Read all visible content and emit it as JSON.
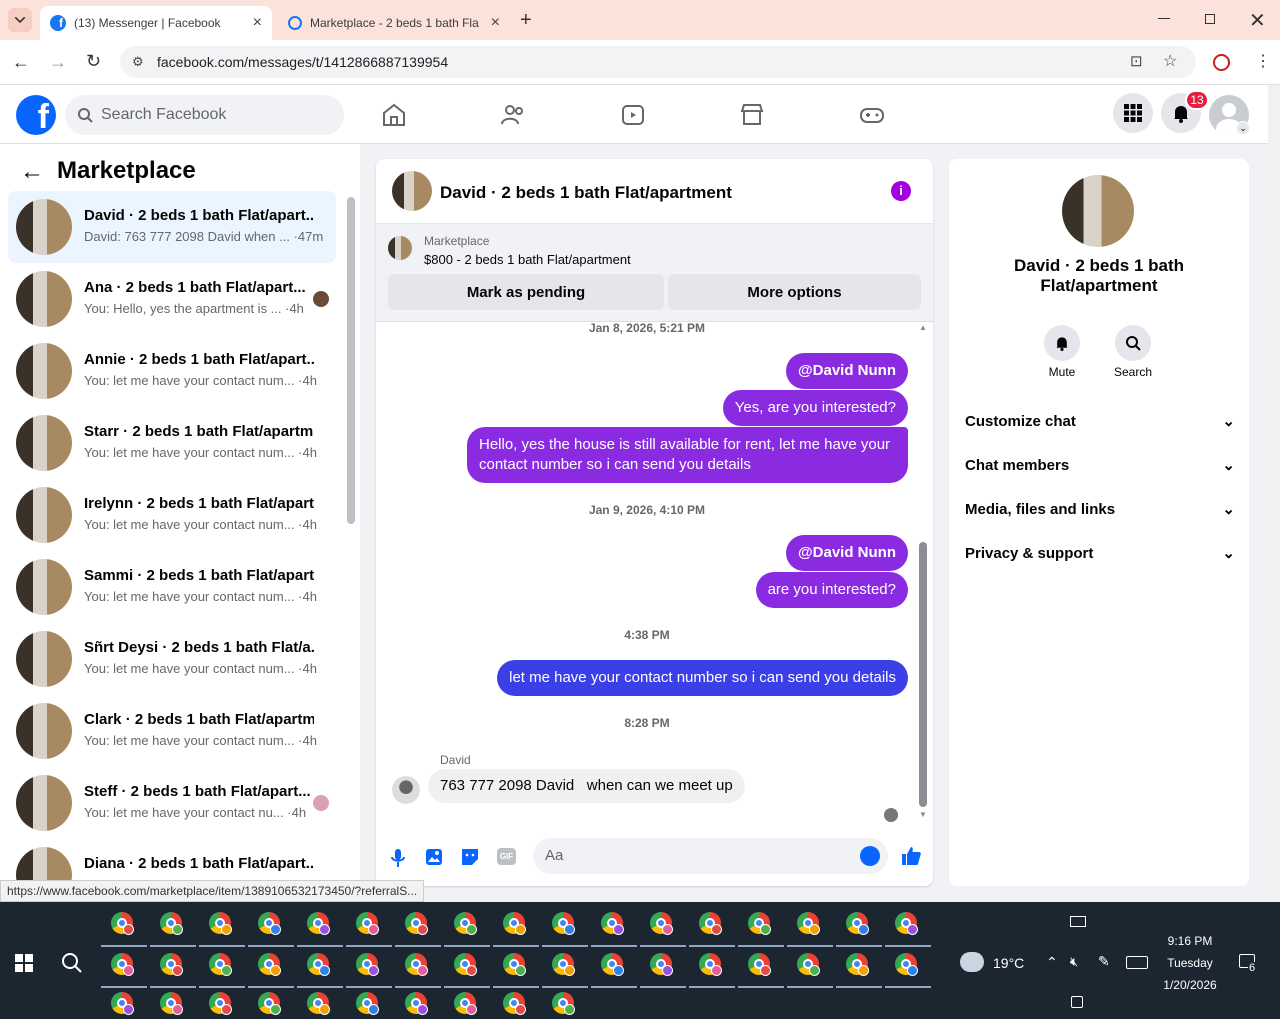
{
  "browser": {
    "tabs": [
      {
        "title": "(13) Messenger | Facebook",
        "active": true
      },
      {
        "title": "Marketplace - 2 beds 1 bath Fla",
        "active": false
      }
    ],
    "url": "facebook.com/messages/t/1412866887139954"
  },
  "fb": {
    "search_placeholder": "Search Facebook",
    "notification_count": "13"
  },
  "sidebar": {
    "title": "Marketplace",
    "conversations": [
      {
        "name": "David · 2 beds 1 bath Flat/apart...",
        "preview": "David: 763 777 2098 David when ... ·47m",
        "selected": true
      },
      {
        "name": "Ana · 2 beds 1 bath Flat/apart...",
        "preview": "You: Hello, yes the apartment is ... ·4h"
      },
      {
        "name": "Annie · 2 beds 1 bath Flat/apart...",
        "preview": "You: let me have your contact num... ·4h"
      },
      {
        "name": "Starr · 2 beds 1 bath Flat/apartm...",
        "preview": "You: let me have your contact num... ·4h"
      },
      {
        "name": "Irelynn · 2 beds 1 bath Flat/apart...",
        "preview": "You: let me have your contact num... ·4h"
      },
      {
        "name": "Sammi · 2 beds 1 bath Flat/apart...",
        "preview": "You: let me have your contact num... ·4h"
      },
      {
        "name": "Sñrt Deysi · 2 beds 1 bath Flat/a...",
        "preview": "You: let me have your contact num... ·4h"
      },
      {
        "name": "Clark · 2 beds 1 bath Flat/apartm...",
        "preview": "You: let me have your contact num... ·4h"
      },
      {
        "name": "Steff · 2 beds 1 bath Flat/apart...",
        "preview": "You: let me have your contact nu... ·4h"
      },
      {
        "name": "Diana · 2 beds 1 bath Flat/apart...",
        "preview": ""
      }
    ]
  },
  "chat": {
    "title": "David · 2 beds 1 bath Flat/apartment",
    "listing_label": "Marketplace",
    "listing": "$800 - 2 beds 1 bath Flat/apartment",
    "mark_pending": "Mark as pending",
    "more_options": "More options",
    "messages": {
      "ts1": "Jan 8, 2026, 5:21 PM",
      "m1": "@David Nunn",
      "m2": "Yes, are you interested?",
      "m3": "Hello, yes the house is still available for rent, let me have your contact number so i can send you details",
      "ts2": "Jan 9, 2026, 4:10 PM",
      "m4": "@David Nunn",
      "m5": "are you interested?",
      "ts3": "4:38 PM",
      "m6": "let me have your contact number so i can send you details",
      "ts4": "8:28 PM",
      "sender": "David",
      "m7": "763 777 2098 David   when can we meet up"
    },
    "composer_placeholder": "Aa"
  },
  "info": {
    "name": "David · 2 beds 1 bath Flat/apartment",
    "mute": "Mute",
    "search": "Search",
    "sections": [
      "Customize chat",
      "Chat members",
      "Media, files and links",
      "Privacy & support"
    ]
  },
  "status_url": "https://www.facebook.com/marketplace/item/1389106532173450/?referralS...",
  "taskbar": {
    "weather": "19°C",
    "time": "9:16 PM",
    "day": "Tuesday",
    "date": "1/20/2026",
    "notif_count": "6"
  }
}
